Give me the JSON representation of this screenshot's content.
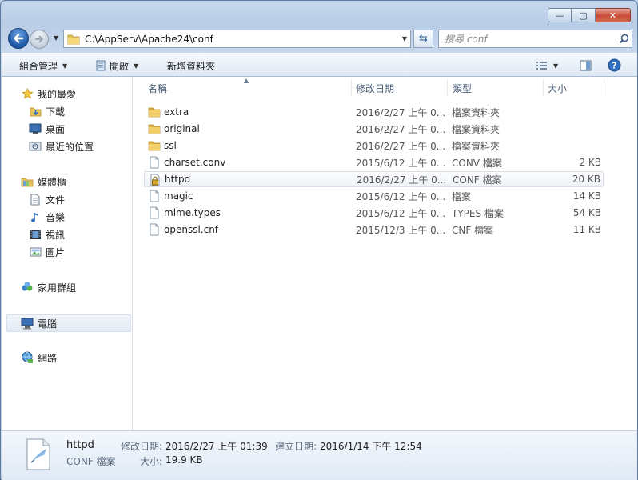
{
  "window": {
    "minimize_glyph": "—",
    "maximize_glyph": "▢",
    "close_glyph": "✕"
  },
  "navigation": {
    "address": "C:\\AppServ\\Apache24\\conf",
    "search_placeholder": "搜尋 conf"
  },
  "toolbar": {
    "organize_label": "組合管理",
    "open_label": "開啟",
    "new_folder_label": "新增資料夾"
  },
  "sidebar": {
    "favorites": {
      "label": "我的最愛",
      "items": [
        {
          "label": "下載",
          "icon": "download-folder-icon"
        },
        {
          "label": "桌面",
          "icon": "desktop-icon"
        },
        {
          "label": "最近的位置",
          "icon": "recent-places-icon"
        }
      ]
    },
    "libraries": {
      "label": "媒體櫃",
      "items": [
        {
          "label": "文件",
          "icon": "documents-icon"
        },
        {
          "label": "音樂",
          "icon": "music-icon"
        },
        {
          "label": "視訊",
          "icon": "video-icon"
        },
        {
          "label": "圖片",
          "icon": "pictures-icon"
        }
      ]
    },
    "homegroup": {
      "label": "家用群組"
    },
    "computer": {
      "label": "電腦",
      "selected": true
    },
    "network": {
      "label": "網路"
    }
  },
  "columns": {
    "name": "名稱",
    "modified": "修改日期",
    "type": "類型",
    "size": "大小"
  },
  "files": [
    {
      "name": "extra",
      "modified": "2016/2/27 上午 0...",
      "type": "檔案資料夾",
      "size": "",
      "icon": "folder-icon"
    },
    {
      "name": "original",
      "modified": "2016/2/27 上午 0...",
      "type": "檔案資料夾",
      "size": "",
      "icon": "folder-icon"
    },
    {
      "name": "ssl",
      "modified": "2016/2/27 上午 0...",
      "type": "檔案資料夾",
      "size": "",
      "icon": "folder-icon"
    },
    {
      "name": "charset.conv",
      "modified": "2015/6/12 上午 0...",
      "type": "CONV 檔案",
      "size": "2 KB",
      "icon": "file-icon"
    },
    {
      "name": "httpd",
      "modified": "2016/2/27 上午 0...",
      "type": "CONF 檔案",
      "size": "20 KB",
      "icon": "locked-file-icon",
      "selected": true
    },
    {
      "name": "magic",
      "modified": "2015/6/12 上午 0...",
      "type": "檔案",
      "size": "14 KB",
      "icon": "file-icon"
    },
    {
      "name": "mime.types",
      "modified": "2015/6/12 上午 0...",
      "type": "TYPES 檔案",
      "size": "54 KB",
      "icon": "file-icon"
    },
    {
      "name": "openssl.cnf",
      "modified": "2015/12/3 上午 0...",
      "type": "CNF 檔案",
      "size": "11 KB",
      "icon": "file-icon"
    }
  ],
  "details": {
    "name": "httpd",
    "type": "CONF 檔案",
    "modified_label": "修改日期:",
    "modified_value": "2016/2/27 上午 01:39",
    "created_label": "建立日期:",
    "created_value": "2016/1/14 下午 12:54",
    "size_label": "大小:",
    "size_value": "19.9 KB"
  }
}
